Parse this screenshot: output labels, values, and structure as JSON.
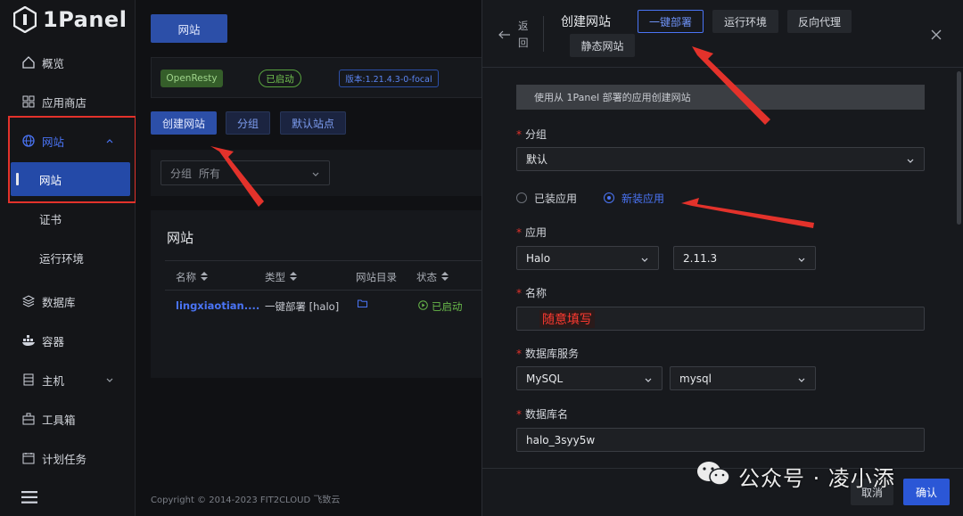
{
  "app": {
    "logo_text": "1Panel"
  },
  "sidebar": {
    "items": [
      {
        "label": "概览",
        "icon": "home-icon"
      },
      {
        "label": "应用商店",
        "icon": "apps-icon"
      },
      {
        "label": "网站",
        "icon": "globe-icon"
      },
      {
        "label": "数据库",
        "icon": "database-icon"
      },
      {
        "label": "容器",
        "icon": "docker-icon"
      },
      {
        "label": "主机",
        "icon": "server-icon"
      },
      {
        "label": "工具箱",
        "icon": "toolbox-icon"
      },
      {
        "label": "计划任务",
        "icon": "calendar-icon"
      }
    ],
    "subitems": [
      {
        "label": "网站"
      },
      {
        "label": "证书"
      },
      {
        "label": "运行环境"
      }
    ]
  },
  "main": {
    "tab": "网站",
    "status": {
      "openresty": "OpenResty",
      "started": "已启动",
      "version": "版本:1.21.4.3-0-focal"
    },
    "toolbar": {
      "create_label": "创建网站",
      "group_label": "分组",
      "default_label": "默认站点"
    },
    "filter": {
      "label": "分组",
      "value": "所有"
    },
    "site_panel_title": "网站",
    "table": {
      "headers": [
        "名称",
        "类型",
        "网站目录",
        "状态"
      ],
      "row": {
        "name": "lingxiaotian....",
        "type": "一键部署 [halo]",
        "status": "已启动"
      }
    },
    "footer": "Copyright © 2014-2023 FIT2CLOUD 飞致云"
  },
  "drawer": {
    "back_label": "返回",
    "title": "创建网站",
    "tabs": [
      "一键部署",
      "运行环境",
      "反向代理",
      "静态网站"
    ],
    "info": "使用从 1Panel 部署的应用创建网站",
    "group": {
      "label": "分组",
      "value": "默认"
    },
    "radios": {
      "installed": "已装应用",
      "new": "新装应用"
    },
    "app": {
      "label": "应用",
      "name": "Halo",
      "version": "2.11.3"
    },
    "name": {
      "label": "名称",
      "value": "随意填写"
    },
    "db_service": {
      "label": "数据库服务",
      "type": "MySQL",
      "instance": "mysql"
    },
    "db_name": {
      "label": "数据库名",
      "value": "halo_3syy5w"
    },
    "cancel_label": "取消",
    "confirm_label": "确认"
  },
  "watermark": {
    "text": "公众号 · 凌小添"
  },
  "colors": {
    "accent": "#2c4fa8",
    "highlight_red": "#e3322b",
    "status_green": "#68b84a"
  }
}
